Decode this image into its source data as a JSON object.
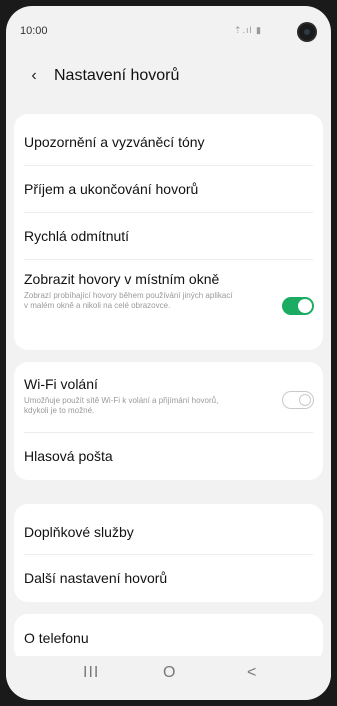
{
  "status_bar": {
    "time": "10:00",
    "icons": "⇡.ıl ▮"
  },
  "header": {
    "back_icon": "‹",
    "title": "Nastavení hovorů"
  },
  "group1": {
    "item1": {
      "label": "Upozornění a vyzváněcí tóny"
    },
    "item2": {
      "label": "Příjem a ukončování hovorů"
    },
    "item3": {
      "label": "Rychlá odmítnutí"
    },
    "item4": {
      "label": "Zobrazit hovory v místním okně",
      "sub": "Zobrazí probíhající hovory během používání jiných aplikací v malém okně a nikoli na celé obrazovce.",
      "toggle": "on"
    }
  },
  "group2": {
    "item1": {
      "label": "Wi-Fi volání",
      "sub": "Umožňuje použít sítě Wi-Fi k volání a přijímání hovorů, kdykoli je to možné.",
      "toggle": "off"
    },
    "item2": {
      "label": "Hlasová pošta"
    }
  },
  "group3": {
    "item1": {
      "label": "Doplňkové služby"
    },
    "item2": {
      "label": "Další nastavení hovorů"
    }
  },
  "group4": {
    "item1": {
      "label": "O telefonu"
    }
  },
  "nav": {
    "recents": "III",
    "home": "O",
    "back": "<"
  },
  "colors": {
    "toggle_on": "#1cab62",
    "background": "#f2f2f2",
    "card": "#ffffff"
  }
}
